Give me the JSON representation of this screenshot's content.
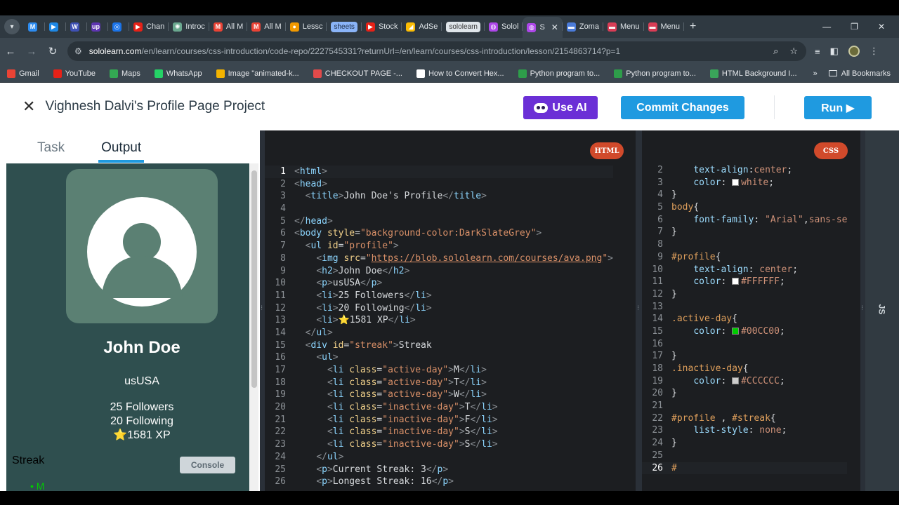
{
  "browser": {
    "tabs": [
      {
        "label": "",
        "fav": "M",
        "color": "#2d8cf0"
      },
      {
        "label": "",
        "fav": "▶",
        "color": "#1e88e5"
      },
      {
        "label": "",
        "fav": "W",
        "color": "#3f51b5"
      },
      {
        "label": "",
        "fav": "up",
        "color": "#5e35b1"
      },
      {
        "label": "",
        "fav": "◎",
        "color": "#1a73e8"
      },
      {
        "label": "Chan",
        "fav": "▶",
        "color": "#e62117"
      },
      {
        "label": "Introc",
        "fav": "✺",
        "color": "#6aa88f"
      },
      {
        "label": "All M",
        "fav": "M",
        "color": "#ea4335"
      },
      {
        "label": "All M",
        "fav": "M",
        "color": "#ea4335"
      },
      {
        "label": "Lessc",
        "fav": "●",
        "color": "#f29900"
      },
      {
        "label": "sheets",
        "pill": "blue"
      },
      {
        "label": "Stock",
        "fav": "▶",
        "color": "#e62117"
      },
      {
        "label": "AdSe",
        "fav": "◢",
        "color": "#fbbc04"
      },
      {
        "label": "sololearn",
        "pill": "grey"
      },
      {
        "label": "Solol",
        "fav": "◍",
        "color": "#ad46e8"
      },
      {
        "label": "S",
        "fav": "◍",
        "color": "#ad46e8",
        "active": true
      },
      {
        "label": "Zoma",
        "fav": "▬",
        "color": "#4a7bd9"
      },
      {
        "label": "Menu",
        "fav": "▬",
        "color": "#d93c55"
      },
      {
        "label": "Menu",
        "fav": "▬",
        "color": "#d93c55"
      }
    ],
    "url_host": "sololearn.com",
    "url_path": "/en/learn/courses/css-introduction/code-repo/2227545331?returnUrl=/en/learn/courses/css-introduction/lesson/2154863714?p=1",
    "bookmarks": [
      {
        "label": "Gmail",
        "color": "#ea4335"
      },
      {
        "label": "YouTube",
        "color": "#e62117"
      },
      {
        "label": "Maps",
        "color": "#34a853"
      },
      {
        "label": "WhatsApp",
        "color": "#25d366"
      },
      {
        "label": "Image \"animated-k...",
        "color": "#f4b400"
      },
      {
        "label": "CHECKOUT PAGE -...",
        "color": "#e24a4a"
      },
      {
        "label": "How to Convert Hex...",
        "color": "#ffffff"
      },
      {
        "label": "Python program to...",
        "color": "#2e9d4a"
      },
      {
        "label": "Python program to...",
        "color": "#2e9d4a"
      },
      {
        "label": "HTML Background I...",
        "color": "#3aa55a"
      }
    ],
    "all_bookmarks": "All Bookmarks"
  },
  "header": {
    "project_title": "Vighnesh Dalvi's Profile Page Project",
    "use_ai": "Use AI",
    "commit": "Commit Changes",
    "run": "Run ▶"
  },
  "left": {
    "tab_task": "Task",
    "tab_output": "Output",
    "name": "John Doe",
    "country": "usUSA",
    "followers": "25 Followers",
    "following": "20 Following",
    "xp": "⭐1581 XP",
    "streak": "Streak",
    "streak_item": "M",
    "console": "Console"
  },
  "html_badge": "HTML",
  "css_badge": "CSS",
  "js_label": "JS",
  "html_lines": [
    "1",
    "2",
    "3",
    "4",
    "5",
    "6",
    "7",
    "8",
    "9",
    "10",
    "11",
    "12",
    "13",
    "14",
    "15",
    "16",
    "17",
    "18",
    "19",
    "20",
    "21",
    "22",
    "23",
    "24",
    "25",
    "26"
  ],
  "css_lines": [
    "2",
    "3",
    "4",
    "5",
    "6",
    "7",
    "8",
    "9",
    "10",
    "11",
    "12",
    "13",
    "14",
    "15",
    "16",
    "17",
    "18",
    "19",
    "20",
    "21",
    "22",
    "23",
    "24",
    "25",
    "26"
  ],
  "colors": {
    "output_bg": "#2f4f4f",
    "accent_blue": "#1f9ae0",
    "ai_purple": "#6b2fd6",
    "active_day": "#00CC00",
    "inactive_day": "#CCCCCC"
  }
}
